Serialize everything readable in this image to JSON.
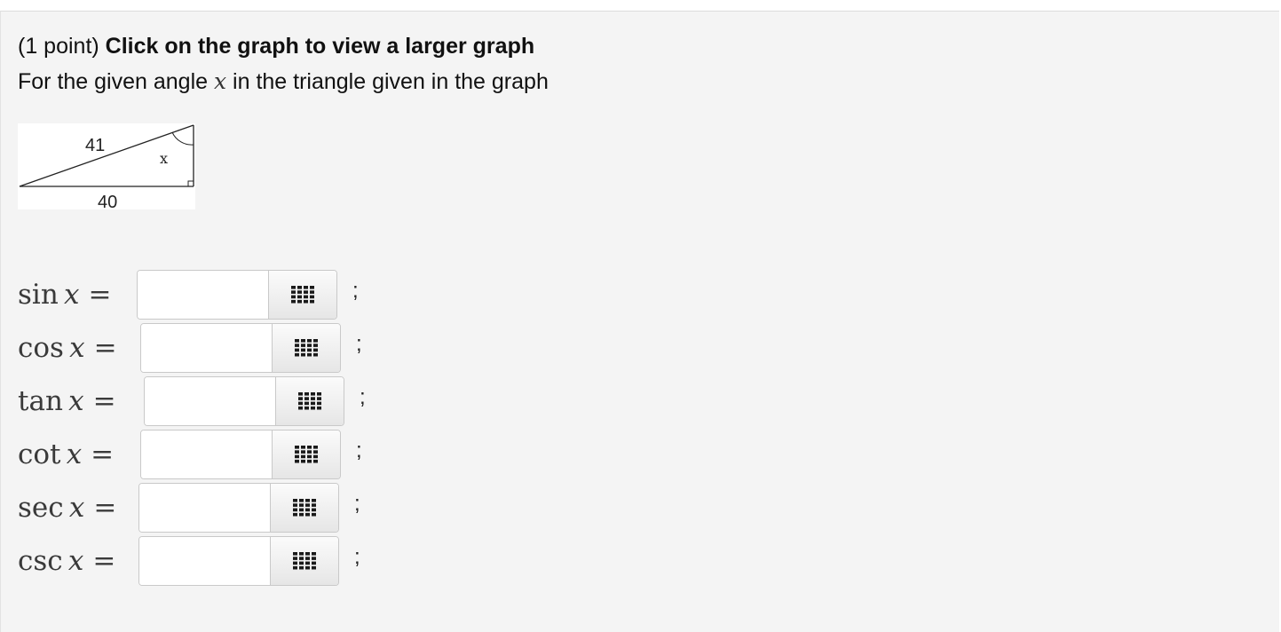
{
  "question": {
    "points": "(1 point)",
    "title": "Click on the graph to view a larger graph",
    "prompt_before": "For the given angle",
    "prompt_var": "x",
    "prompt_after": "in the triangle given in the graph"
  },
  "figure": {
    "hypotenuse_label": "41",
    "base_label": "40",
    "angle_label": "x"
  },
  "rows": [
    {
      "fn": "sin",
      "var": "x",
      "eq": "=",
      "value": "",
      "suffix": ";"
    },
    {
      "fn": "cos",
      "var": "x",
      "eq": "=",
      "value": "",
      "suffix": ";"
    },
    {
      "fn": "tan",
      "var": "x",
      "eq": "=",
      "value": "",
      "suffix": ";"
    },
    {
      "fn": "cot",
      "var": "x",
      "eq": "=",
      "value": "",
      "suffix": ";"
    },
    {
      "fn": "sec",
      "var": "x",
      "eq": "=",
      "value": "",
      "suffix": ";"
    },
    {
      "fn": "csc",
      "var": "x",
      "eq": "=",
      "value": "",
      "suffix": ";"
    }
  ],
  "icons": {
    "equation_editor": "grid-keypad-icon"
  }
}
